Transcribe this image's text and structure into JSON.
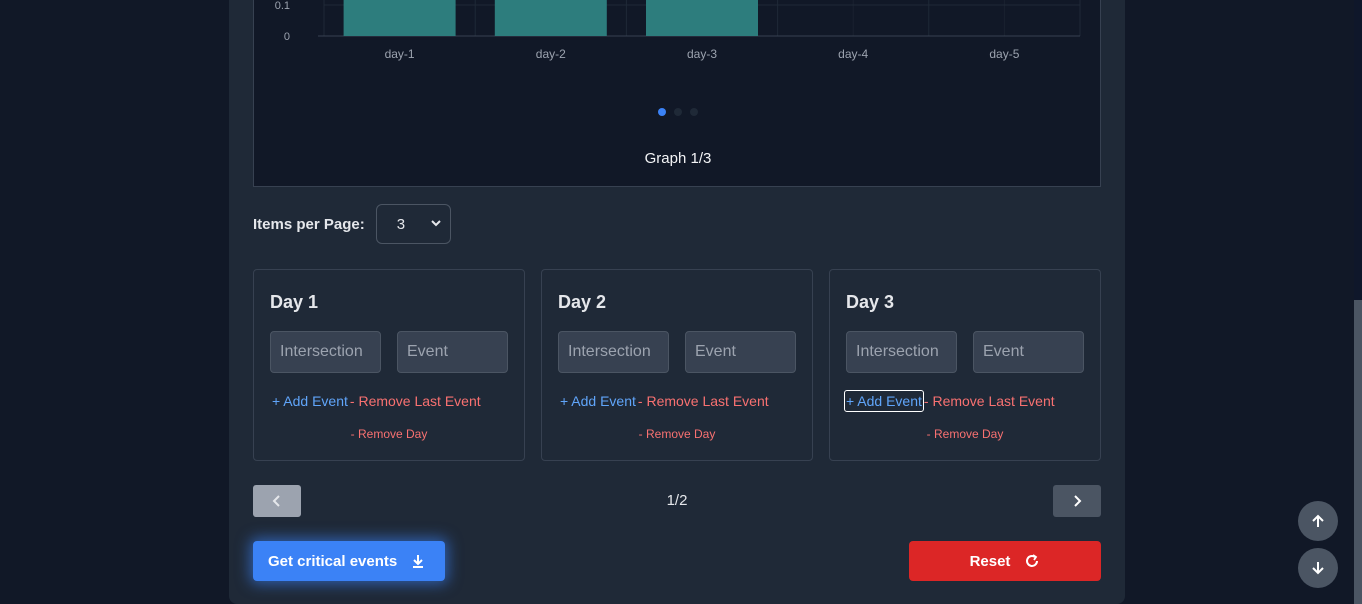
{
  "chart": {
    "graph_label": "Graph 1/3",
    "dots": 3,
    "active_dot": 0
  },
  "chart_data": {
    "type": "bar",
    "categories": [
      "day-1",
      "day-2",
      "day-3",
      "day-4",
      "day-5"
    ],
    "values": [
      0.16,
      0.16,
      0.16,
      0,
      0
    ],
    "y_ticks_visible": [
      "0.1",
      "0"
    ],
    "bar_color": "#2d7d7d",
    "grid": true
  },
  "pagination_size": {
    "label": "Items per Page:",
    "value": "3"
  },
  "days": [
    {
      "title": "Day 1",
      "intersection_placeholder": "Intersection",
      "event_placeholder": "Event",
      "add_event": "+ Add Event",
      "remove_event": "- Remove Last Event",
      "remove_day": "- Remove Day"
    },
    {
      "title": "Day 2",
      "intersection_placeholder": "Intersection",
      "event_placeholder": "Event",
      "add_event": "+ Add Event",
      "remove_event": "- Remove Last Event",
      "remove_day": "- Remove Day"
    },
    {
      "title": "Day 3",
      "intersection_placeholder": "Intersection",
      "event_placeholder": "Event",
      "add_event": "+ Add Event",
      "remove_event": "- Remove Last Event",
      "remove_day": "- Remove Day"
    }
  ],
  "pager": {
    "text": "1/2"
  },
  "buttons": {
    "critical": "Get critical events",
    "reset": "Reset"
  },
  "colors": {
    "accent": "#3b82f6",
    "danger": "#dc2626",
    "link": "#60a5fa",
    "danger_link": "#f87171"
  },
  "icons": {
    "download": "download-icon",
    "refresh": "refresh-icon",
    "prev": "chevron-left-icon",
    "next": "chevron-right-icon",
    "scroll_up": "arrow-up-icon",
    "scroll_down": "arrow-down-icon"
  }
}
